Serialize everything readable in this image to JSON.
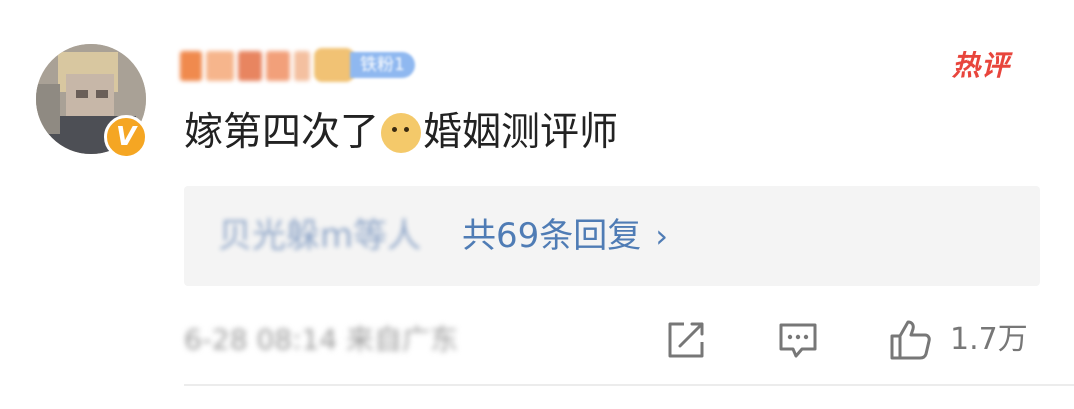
{
  "comment": {
    "user": {
      "name": "",
      "fan_badge": "铁粉1",
      "verified_badge": "V"
    },
    "hot_tag": "热评",
    "content_before_emoji": "嫁第四次了",
    "emoji": "dog-emoji",
    "content_after_emoji": "婚姻测评师",
    "replies": {
      "users_text": "贝光躲m等人",
      "count_text": "共69条回复",
      "chevron": "›"
    },
    "footer": {
      "meta_text": "6-28 08:14 来自广东",
      "likes": "1.7万"
    },
    "colors": {
      "link": "#4f7cb5",
      "hot": "#e8453c",
      "badge": "#f5a623"
    }
  }
}
